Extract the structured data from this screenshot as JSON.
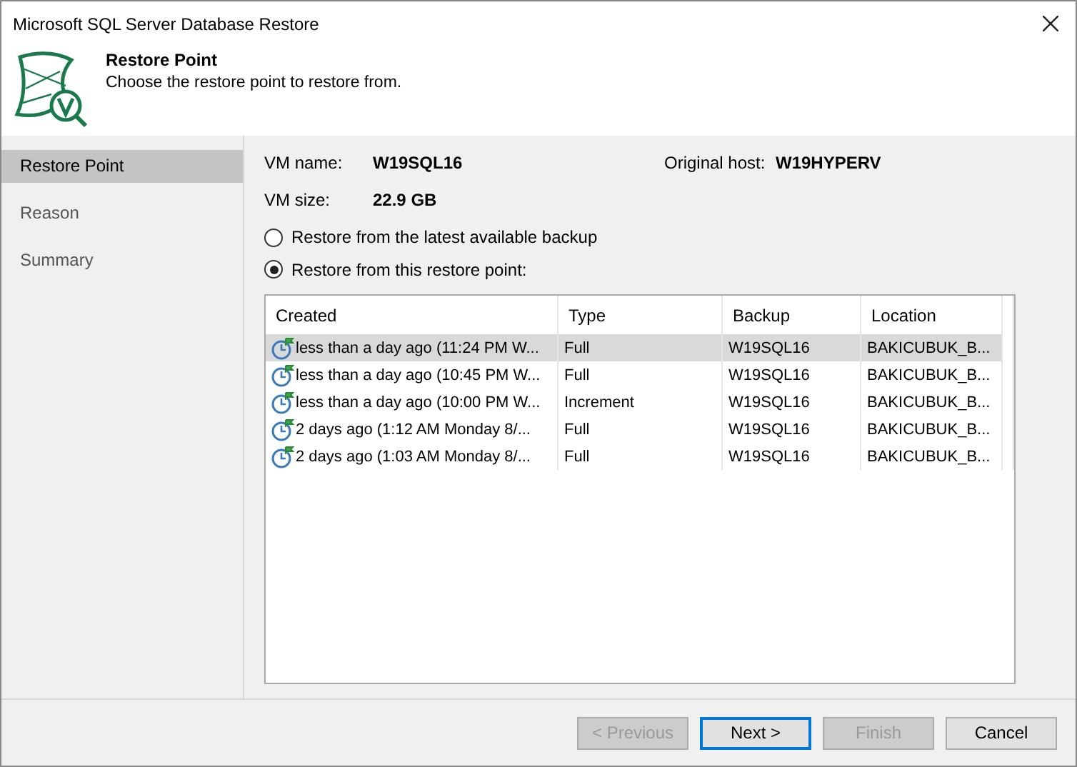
{
  "window": {
    "title": "Microsoft SQL Server Database Restore"
  },
  "header": {
    "title": "Restore Point",
    "subtitle": "Choose the restore point to restore from."
  },
  "sidebar": {
    "items": [
      {
        "label": "Restore Point",
        "selected": true
      },
      {
        "label": "Reason",
        "selected": false
      },
      {
        "label": "Summary",
        "selected": false
      }
    ]
  },
  "info": {
    "vm_name_label": "VM name:",
    "vm_name": "W19SQL16",
    "host_label": "Original host:",
    "host": "W19HYPERV",
    "size_label": "VM size:",
    "size": "22.9 GB"
  },
  "options": [
    {
      "label": "Restore from the latest available backup",
      "selected": false
    },
    {
      "label": "Restore from this restore point:",
      "selected": true
    }
  ],
  "table": {
    "columns": [
      "Created",
      "Type",
      "Backup",
      "Location"
    ],
    "rows": [
      {
        "cells": [
          "less than a day ago (11:24 PM W...",
          "Full",
          "W19SQL16",
          "BAKICUBUK_B..."
        ],
        "selected": true
      },
      {
        "cells": [
          "less than a day ago (10:45 PM W...",
          "Full",
          "W19SQL16",
          "BAKICUBUK_B..."
        ],
        "selected": false
      },
      {
        "cells": [
          "less than a day ago (10:00 PM W...",
          "Increment",
          "W19SQL16",
          "BAKICUBUK_B..."
        ],
        "selected": false
      },
      {
        "cells": [
          "2 days ago (1:12 AM Monday 8/...",
          "Full",
          "W19SQL16",
          "BAKICUBUK_B..."
        ],
        "selected": false
      },
      {
        "cells": [
          "2 days ago (1:03 AM Monday 8/...",
          "Full",
          "W19SQL16",
          "BAKICUBUK_B..."
        ],
        "selected": false
      }
    ]
  },
  "buttons": [
    {
      "label": "< Previous",
      "disabled": true,
      "default": false
    },
    {
      "label": "Next >",
      "disabled": false,
      "default": true
    },
    {
      "label": "Finish",
      "disabled": true,
      "default": false
    },
    {
      "label": "Cancel",
      "disabled": false,
      "default": false
    }
  ]
}
